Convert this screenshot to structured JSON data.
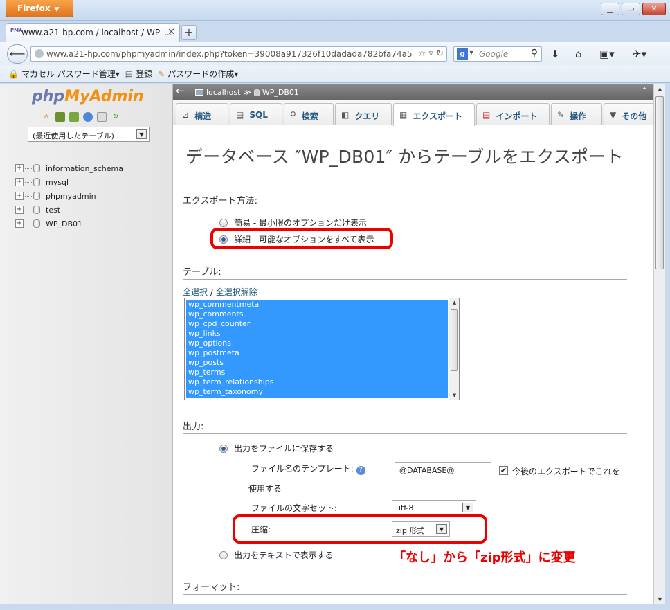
{
  "browser": {
    "app_button": "Firefox",
    "tab_title": "www.a21-hp.com / localhost / WP_...",
    "tab_favicon": "PMA",
    "new_tab": "+",
    "url": "www.a21-hp.com/phpmyadmin/index.php?token=39008a917326f10dadada782bfa74a5",
    "search_placeholder": "Google",
    "bookmarks": [
      {
        "label": "マカセル パスワード管理▾",
        "icon": "lock-icon"
      },
      {
        "label": "登録",
        "icon": "register-icon"
      },
      {
        "label": "パスワードの作成▾",
        "icon": "wand-icon"
      }
    ]
  },
  "nav": {
    "logo_php": "php",
    "logo_myadmin": "MyAdmin",
    "recent_tables": "(最近使用したテーブル) ...",
    "databases": [
      "information_schema",
      "mysql",
      "phpmyadmin",
      "test",
      "WP_DB01"
    ]
  },
  "breadcrumb": {
    "server": "localhost",
    "separator": "≫",
    "database": "WP_DB01"
  },
  "tabs": [
    {
      "label": "構造",
      "icon": "structure-icon"
    },
    {
      "label": "SQL",
      "icon": "sql-icon"
    },
    {
      "label": "検索",
      "icon": "search-icon"
    },
    {
      "label": "クエリ",
      "icon": "query-icon"
    },
    {
      "label": "エクスポート",
      "icon": "export-icon",
      "active": true
    },
    {
      "label": "インポート",
      "icon": "import-icon"
    },
    {
      "label": "操作",
      "icon": "wrench-icon"
    },
    {
      "label": "その他",
      "icon": "chevron-down-icon"
    }
  ],
  "page": {
    "title": "データベース ″WP_DB01″ からテーブルをエクスポート",
    "export_method": {
      "heading": "エクスポート方法:",
      "option_quick": "簡易 - 最小限のオプションだけ表示",
      "option_custom": "詳細 - 可能なオプションをすべて表示",
      "selected": "custom"
    },
    "tables": {
      "heading": "テーブル:",
      "select_all": "全選択",
      "separator": "/",
      "unselect_all": "全選択解除",
      "items": [
        "wp_commentmeta",
        "wp_comments",
        "wp_cpd_counter",
        "wp_links",
        "wp_options",
        "wp_postmeta",
        "wp_posts",
        "wp_terms",
        "wp_term_relationships",
        "wp_term_taxonomy"
      ]
    },
    "output": {
      "heading": "出力:",
      "save_to_file": "出力をファイルに保存する",
      "filename_template_label": "ファイル名のテンプレート:",
      "filename_template_value": "@DATABASE@",
      "remember_label_1": "今後のエクスポートでこれを",
      "remember_label_2": "使用する",
      "remember_checked": true,
      "charset_label": "ファイルの文字セット:",
      "charset_value": "utf-8",
      "compression_label": "圧縮:",
      "compression_value": "zip 形式",
      "view_as_text": "出力をテキストで表示する"
    },
    "annotation": "「なし」から「zip形式」に変更",
    "format_heading": "フォーマット:"
  },
  "colors": {
    "highlight_red": "#ee0000",
    "selection_blue": "#3399ff",
    "link_blue": "#235a81"
  }
}
